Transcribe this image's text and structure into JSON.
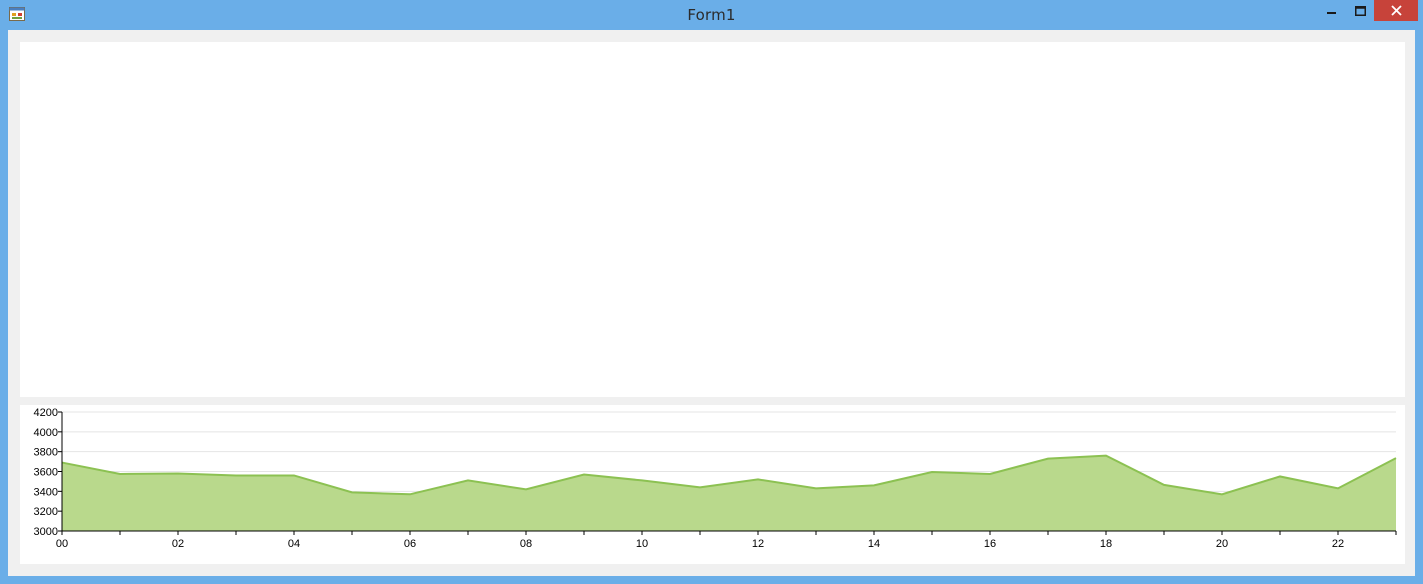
{
  "window": {
    "title": "Form1",
    "icons": {
      "app": "app-form-icon",
      "minimize": "minimize-icon",
      "maximize": "maximize-icon",
      "close": "close-icon"
    },
    "colors": {
      "frame": "#6aaee8",
      "close_button": "#c7433a",
      "client": "#f0f0f0"
    }
  },
  "chart_data": {
    "type": "area",
    "x": [
      "00",
      "01",
      "02",
      "03",
      "04",
      "05",
      "06",
      "07",
      "08",
      "09",
      "10",
      "11",
      "12",
      "13",
      "14",
      "15",
      "16",
      "17",
      "18",
      "19",
      "20",
      "21",
      "22",
      "23"
    ],
    "x_tick_labels": [
      "00",
      "02",
      "04",
      "06",
      "08",
      "10",
      "12",
      "14",
      "16",
      "18",
      "20",
      "22"
    ],
    "y_tick_labels": [
      "3000",
      "3200",
      "3400",
      "3600",
      "3800",
      "4000",
      "4200"
    ],
    "series": [
      {
        "values": [
          3690,
          3575,
          3580,
          3560,
          3560,
          3390,
          3370,
          3510,
          3420,
          3570,
          3510,
          3440,
          3520,
          3430,
          3460,
          3595,
          3575,
          3730,
          3760,
          3465,
          3370,
          3550,
          3430,
          3735
        ],
        "color": "#b9d98c",
        "line_color": "#8cc152"
      }
    ],
    "ylim": [
      3000,
      4200
    ],
    "grid": {
      "y": true,
      "x": false
    },
    "legend": "none",
    "title": "",
    "xlabel": "",
    "ylabel": ""
  }
}
